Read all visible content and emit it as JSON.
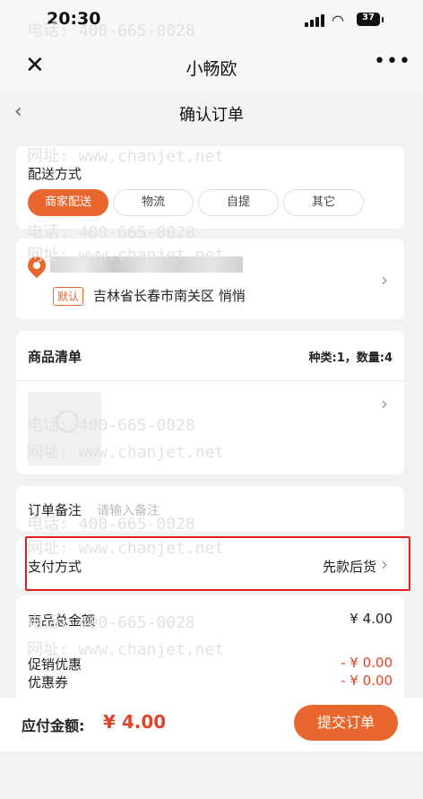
{
  "status_bar": {
    "time": "20:30",
    "battery": "37"
  },
  "app_header": {
    "title": "小畅欧",
    "close_icon": "close-icon",
    "more_icon": "more-icon"
  },
  "page_header": {
    "title": "确认订单",
    "back_icon": "chevron-left-icon"
  },
  "delivery": {
    "label": "配送方式",
    "options": [
      "商家配送",
      "物流",
      "自提",
      "其它"
    ],
    "selected": "商家配送"
  },
  "address": {
    "default_tag": "默认",
    "text": "吉林省长春市南关区 悄悄",
    "icon": "location-pin-icon"
  },
  "goods": {
    "title": "商品清单",
    "summary": "种类:1，数量:4"
  },
  "remark": {
    "label": "订单备注",
    "placeholder": "请输入备注"
  },
  "payment": {
    "label": "支付方式",
    "value": "先款后货"
  },
  "amounts": {
    "total_label": "商品总金额",
    "total_value": "¥ 4.00",
    "promo_label": "促销优惠",
    "promo_value": "- ¥ 0.00",
    "coupon_label": "优惠券",
    "coupon_value": "- ¥ 0.00"
  },
  "footer": {
    "payable_label": "应付金额:",
    "payable_value": "¥ 4.00",
    "submit": "提交订单"
  },
  "watermark": {
    "phone": "电话: 400-665-0028",
    "site": "网址: www.chanjet.net"
  },
  "colors": {
    "accent": "#e9672e",
    "price_red": "#e2442a",
    "highlight_border": "#e02020"
  }
}
